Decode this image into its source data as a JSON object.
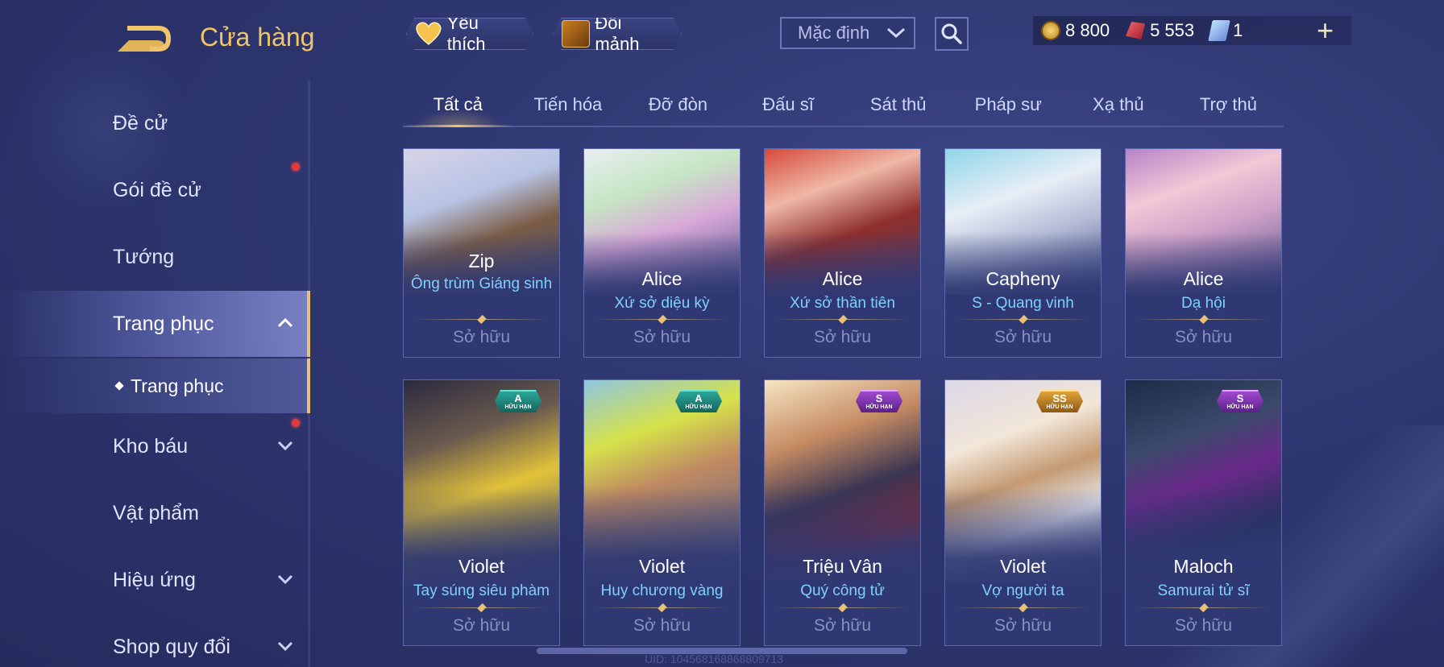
{
  "header": {
    "title": "Cửa hàng",
    "favorite_label": "Yêu thích",
    "exchange_label": "Đổi mảnh",
    "sort_selected": "Mặc định",
    "currencies": [
      {
        "icon": "gold-coin-icon",
        "value": "8 800"
      },
      {
        "icon": "ruby-icon",
        "value": "5 553"
      },
      {
        "icon": "voucher-icon",
        "value": "1"
      }
    ],
    "plus_label": "+"
  },
  "sidebar": {
    "items": [
      {
        "label": "Đề cử"
      },
      {
        "label": "Gói đề cử"
      },
      {
        "label": "Tướng"
      },
      {
        "label": "Trang phục"
      },
      {
        "label": "Kho báu"
      },
      {
        "label": "Vật phẩm"
      },
      {
        "label": "Hiệu ứng"
      },
      {
        "label": "Shop quy đổi"
      }
    ],
    "sub_item": "Trang phục"
  },
  "tabs": [
    "Tất cả",
    "Tiến hóa",
    "Đỡ đòn",
    "Đấu sĩ",
    "Sát thủ",
    "Pháp sư",
    "Xạ thủ",
    "Trợ thủ"
  ],
  "cards": [
    {
      "hero": "Zip",
      "skin": "Ông trùm Giáng sinh",
      "status": "Sở hữu"
    },
    {
      "hero": "Alice",
      "skin": "Xứ sở diệu kỳ",
      "status": "Sở hữu"
    },
    {
      "hero": "Alice",
      "skin": "Xứ sở thần tiên",
      "status": "Sở hữu"
    },
    {
      "hero": "Capheny",
      "skin": "S - Quang vinh",
      "status": "Sở hữu"
    },
    {
      "hero": "Alice",
      "skin": "Dạ hội",
      "status": "Sở hữu"
    },
    {
      "hero": "Violet",
      "skin": "Tay súng siêu phàm",
      "status": "Sở hữu",
      "tier": "A",
      "limited": "HỮU HẠN"
    },
    {
      "hero": "Violet",
      "skin": "Huy chương vàng",
      "status": "Sở hữu",
      "tier": "A",
      "limited": "HỮU HẠN"
    },
    {
      "hero": "Triệu Vân",
      "skin": "Quý công tử",
      "status": "Sở hữu",
      "tier": "S",
      "limited": "HỮU HẠN"
    },
    {
      "hero": "Violet",
      "skin": "Vợ người ta",
      "status": "Sở hữu",
      "tier": "SS",
      "limited": "HỮU HẠN"
    },
    {
      "hero": "Maloch",
      "skin": "Samurai tử sĩ",
      "status": "Sở hữu",
      "tier": "S",
      "limited": "HỮU HẠN"
    }
  ],
  "footer": {
    "uid": "UID: 104568168868809713"
  },
  "colors": {
    "accent_gold": "#f0c46a",
    "skin_name": "#7fd0ff",
    "background": "#2e3670",
    "badge_a": "#2aa79a",
    "badge_s": "#a04ad0",
    "badge_ss": "#e0a23a"
  }
}
